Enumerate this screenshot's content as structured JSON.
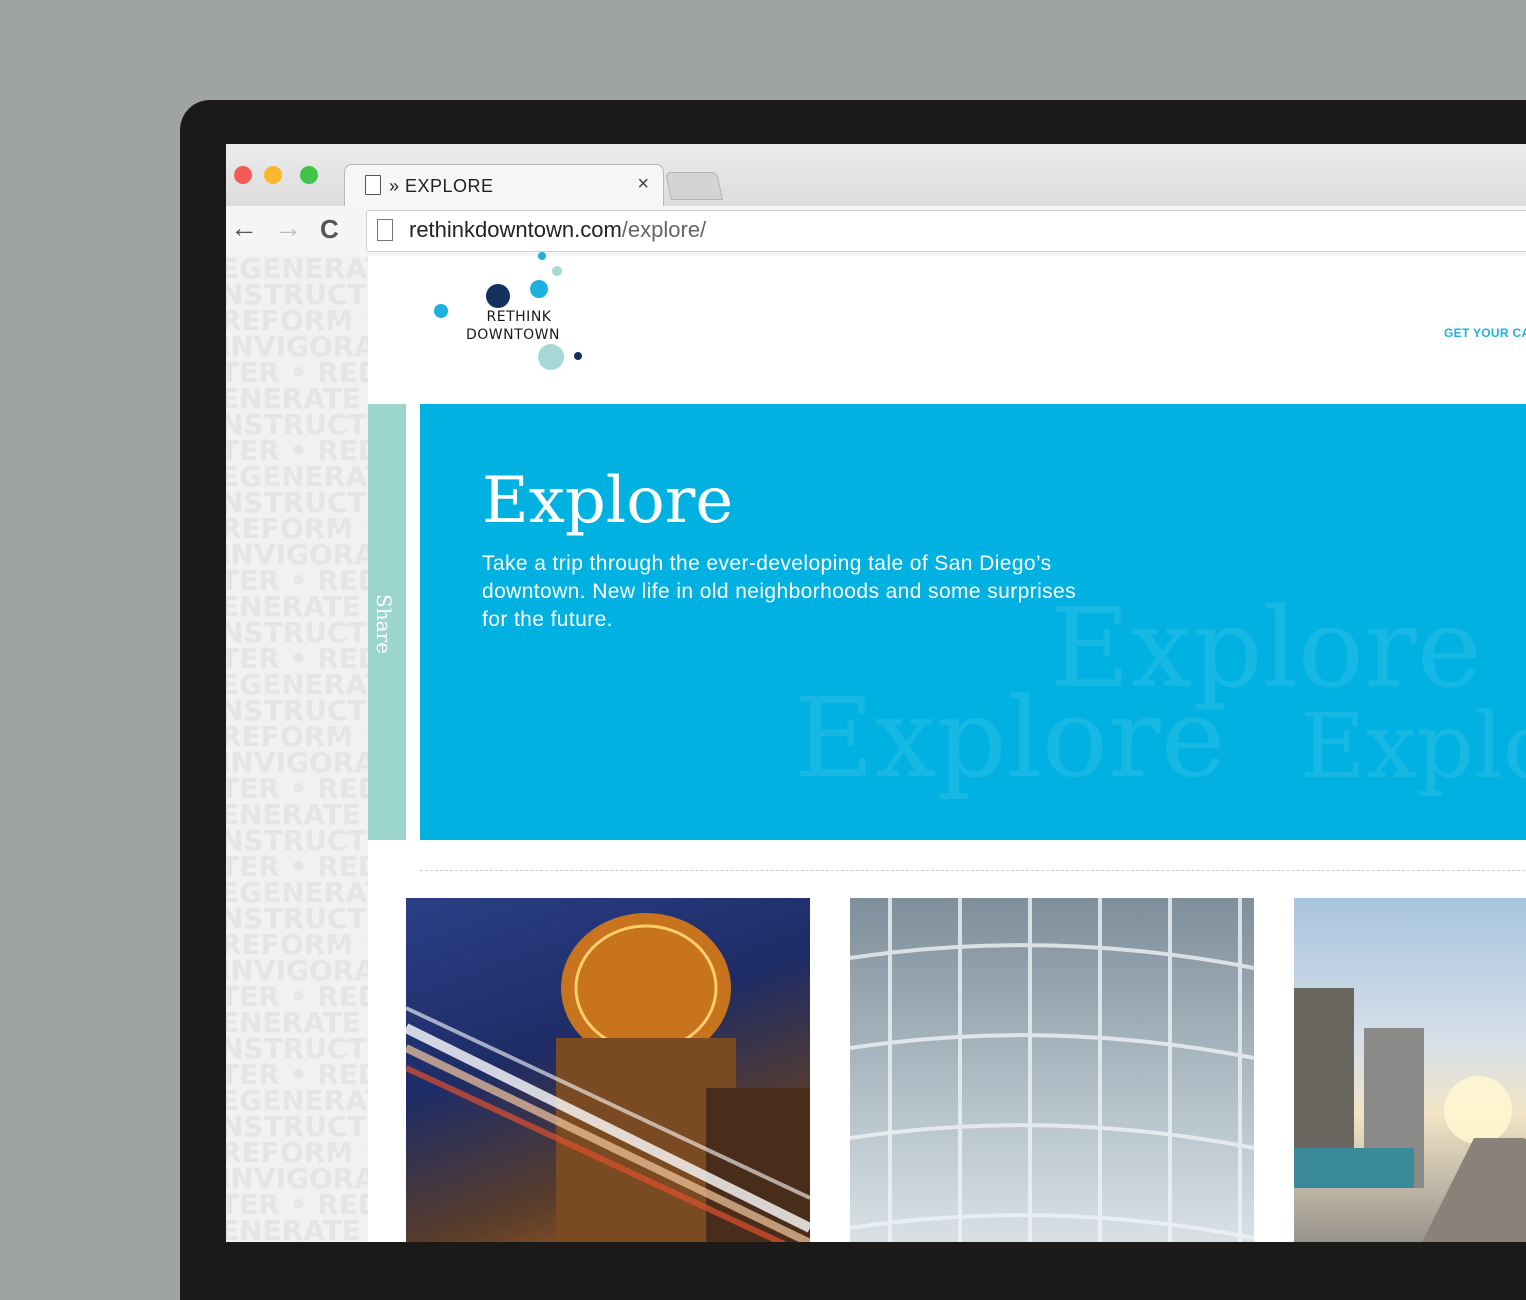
{
  "browser": {
    "tab_title": "» EXPLORE",
    "tab_close": "×",
    "url_domain": "rethinkdowntown.com",
    "url_path": "/explore/",
    "back_icon": "←",
    "forward_icon": "→",
    "reload_icon": "C"
  },
  "background_words": [
    "EGENERATE • RECONSTRUCT",
    "NSTRUCT • REFORM",
    "REFORM • REINVIGORATE",
    "INVIGORATE • REDEFINE",
    "TER • REDEVELOP",
    "ENERATE • REFORM",
    "NSTRUCT • REDEFINE",
    "TER • REDEVELOP",
    "EGENERATE • RECONSTRUCT",
    "NSTRUCT • REFORM",
    "REFORM • REINVIGORATE",
    "INVIGORATE • REDEFINE",
    "TER • REDEVELOP",
    "ENERATE • REFORM",
    "NSTRUCT • REDEFINE",
    "TER • REDEVELOP",
    "EGENERATE • RECONSTRUCT",
    "NSTRUCT • REFORM",
    "REFORM • REINVIGORATE",
    "INVIGORATE • REDEFINE",
    "TER • REDEVELOP",
    "ENERATE • REFORM",
    "NSTRUCT • REDEFINE",
    "TER • REDEVELOP",
    "EGENERATE • RECONSTRUCT",
    "NSTRUCT • REFORM",
    "REFORM • REINVIGORATE",
    "INVIGORATE • REDEFINE",
    "TER • REDEVELOP",
    "ENERATE • REFORM",
    "NSTRUCT • REDEFINE",
    "TER • REDEVELOP",
    "EGENERATE • RECONSTRUCT",
    "NSTRUCT • REFORM",
    "REFORM • REINVIGORATE",
    "INVIGORATE • REDEFINE",
    "TER • REDEVELOP",
    "ENERATE • REFORM"
  ],
  "logo": {
    "line1": "RETHINK",
    "line2": "DOWNTOWN"
  },
  "header": {
    "cta": "GET YOUR CA"
  },
  "share": {
    "label": "Share"
  },
  "hero": {
    "title": "Explore",
    "description": "Take a trip through the ever-developing tale of San Diego’s downtown. New life in old neighborhoods and some surprises for the future.",
    "ghost_words": [
      "Explore",
      "Explore",
      "Explo"
    ]
  },
  "colors": {
    "hero_blue": "#00b1e2",
    "share_teal": "#9cd5ce",
    "logo_navy": "#13305e",
    "logo_light_blue": "#1bb2e0",
    "logo_pale_teal": "#a8d8d6"
  },
  "photos": [
    "night-building-light-trails",
    "glass-apartment-facade",
    "sunset-waterfront-walk"
  ]
}
